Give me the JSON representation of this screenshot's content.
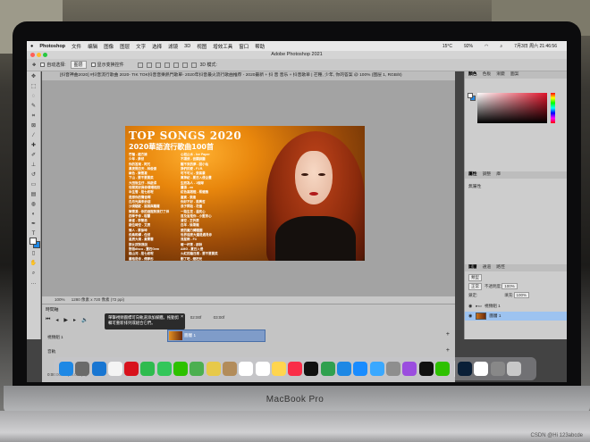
{
  "menubar": {
    "apple": "",
    "app_name": "Photoshop",
    "items": [
      "文件",
      "编辑",
      "图像",
      "图层",
      "文字",
      "选择",
      "滤镜",
      "3D",
      "视图",
      "增效工具",
      "窗口",
      "帮助"
    ],
    "weather": "15°C",
    "battery": "92%",
    "datetime": "7月3日 周六 21:46:56"
  },
  "window": {
    "title": "Adobe Photoshop 2021"
  },
  "options_bar": {
    "auto_select_label": "自动选择:",
    "auto_select_value": "图层",
    "show_transform": "显示变换控件",
    "mode_3d": "3D 模式:"
  },
  "document": {
    "tab_title": "[抖音神曲2020] #抖音流行歌曲 2020- TIK TOK抖音音樂熱門歌單- 2020年抖音最火流行歌曲推荐 - 2020最新 + 抖 音 音乐 + 抖音歌单 | 芒種, 少年, 你的答案 @ 100% (图层 1, RGB/8)",
    "zoom": "100%",
    "dimensions": "1280 像素 x 720 像素 (72 ppi)"
  },
  "artwork": {
    "title": "TOP SONGS 2020",
    "subtitle": "2020華語流行歌曲100首",
    "songs_col1": [
      "芒種 - 趙方婧",
      "少年 - 夢然",
      "你的答案 - 阿冗",
      "黑夜問白天 - 林俊傑",
      "綠色 - 陳雪凝",
      "下山 - 要不要買菜",
      "大田後生仔 - 林啟得",
      "世間美好與你環環相扣",
      "半生雪 - 是七叔呢",
      "是想你的聲音啊",
      "白月光與朱砂痣",
      "沙漠駱駝 - 展展與羅羅",
      "陳雪凝 - 你的酒館對我打了烊",
      "四季予你 - 程響",
      "麻雀 - 李榮浩",
      "錯位時空 - 艾辰",
      "情人 - 蔡徐坤",
      "飛鳥和蟬 - 任然",
      "星辰大海 - 黃霄雲",
      "那女孩對我說",
      "野狼disco - 寶石Gem",
      "踏山河 - 是七叔呢",
      "嚴格是你 - 傅夢彤",
      "讓酒 - 摩登兄弟劉宇寧",
      "DJ 把回憶拼好給你"
    ],
    "songs_col2": [
      "心如止水 - Ice Paper",
      "不謂俠 - 音闕詩聽",
      "醒不來的夢 - 回小仙",
      "我們的愛 - F.I.R.",
      "可不可以 - 張紫豪",
      "萬神紀 - 夏日入侵企畫",
      "生而為人 - 1個球",
      "囂張 - en",
      "紅色高跟鞋 - 蔡健雅",
      "嘉賓 - 張遠",
      "你好不好 - 周興哲",
      "浪子閑話 - 花僮",
      "一路生花 - 溫奕心",
      "目及皆是你 - 小藍背心",
      "清空 - 王忻辰",
      "白羊 - 徐秉龍",
      "愛的魔力轉圈圈",
      "世界這麼大還是遇見你",
      "流星雨 - F4",
      "暖一杯茶 - 邵帥",
      "AMG - 夏日入侵",
      "火紅的薩日朗 - 要不要買菜",
      "刪了吧 - 煙把兒",
      "點歌的人 - 海來阿木",
      "我的將軍啊 - 半陽"
    ]
  },
  "panels": {
    "color_tabs": [
      "顏色",
      "色板",
      "漸變",
      "圖案"
    ],
    "properties_tabs": [
      "屬性",
      "調整",
      "庫"
    ],
    "properties_empty": "無屬性",
    "layers_tabs": [
      "圖層",
      "通道",
      "路徑"
    ],
    "layers_filter": "類型",
    "blend_mode": "正常",
    "opacity_label": "不透明度:",
    "opacity_value": "100%",
    "lock_label": "鎖定:",
    "fill_label": "填充:",
    "fill_value": "100%",
    "layers": [
      {
        "name": "視頻組 1",
        "kind": "group"
      },
      {
        "name": "圖層 1",
        "kind": "layer",
        "selected": true
      }
    ]
  },
  "timeline": {
    "title": "時間軸",
    "ruler": [
      "01:00f",
      "02:00f",
      "03:00f"
    ],
    "tooltip": "單擊視頻圖標可向軌道添加媒體。拖動剪輯可重新排列或組合它們。",
    "track_label": "視頻組 1",
    "clip_label": "圖層 1",
    "audio_label": "音軌",
    "framerate": "0:00:00:00 (30.00 fps)"
  },
  "laptop_label": "MacBook Pro",
  "watermark": "CSDN @Hi 123abcde",
  "dock": {
    "apps": [
      {
        "name": "Finder",
        "color": "#1e88e5"
      },
      {
        "name": "Launchpad",
        "color": "#6a6a6a"
      },
      {
        "name": "Safari",
        "color": "#1976d2"
      },
      {
        "name": "Chrome",
        "color": "#f4f4f4"
      },
      {
        "name": "Opera",
        "color": "#d8121d"
      },
      {
        "name": "FaceTime",
        "color": "#2fbb4f"
      },
      {
        "name": "Messages",
        "color": "#33c65a"
      },
      {
        "name": "WeChat",
        "color": "#2dc100"
      },
      {
        "name": "Maps",
        "color": "#4caf50"
      },
      {
        "name": "Photos",
        "color": "#e7c94a"
      },
      {
        "name": "Contacts",
        "color": "#b28c5b"
      },
      {
        "name": "Calendar",
        "color": "#ffffff"
      },
      {
        "name": "Reminders",
        "color": "#ffffff"
      },
      {
        "name": "Notes",
        "color": "#ffd54f"
      },
      {
        "name": "Music",
        "color": "#fa2d48"
      },
      {
        "name": "TV",
        "color": "#111111"
      },
      {
        "name": "Numbers",
        "color": "#30a04f"
      },
      {
        "name": "Keynote",
        "color": "#1e88e5"
      },
      {
        "name": "App Store",
        "color": "#1a8cff"
      },
      {
        "name": "Baidu Netdisk",
        "color": "#3aa8ff"
      },
      {
        "name": "System Preferences",
        "color": "#8e8e8e"
      },
      {
        "name": "Podcasts",
        "color": "#9b4ddf"
      },
      {
        "name": "QQ",
        "color": "#111111"
      },
      {
        "name": "WeChat Chat",
        "color": "#2dc100"
      },
      {
        "name": "Photoshop",
        "color": "#0a1f37"
      },
      {
        "name": "Preview",
        "color": "#ffffff"
      },
      {
        "name": "Screenshot",
        "color": "#888888"
      },
      {
        "name": "Trash",
        "color": "#c8c8c8"
      }
    ]
  }
}
